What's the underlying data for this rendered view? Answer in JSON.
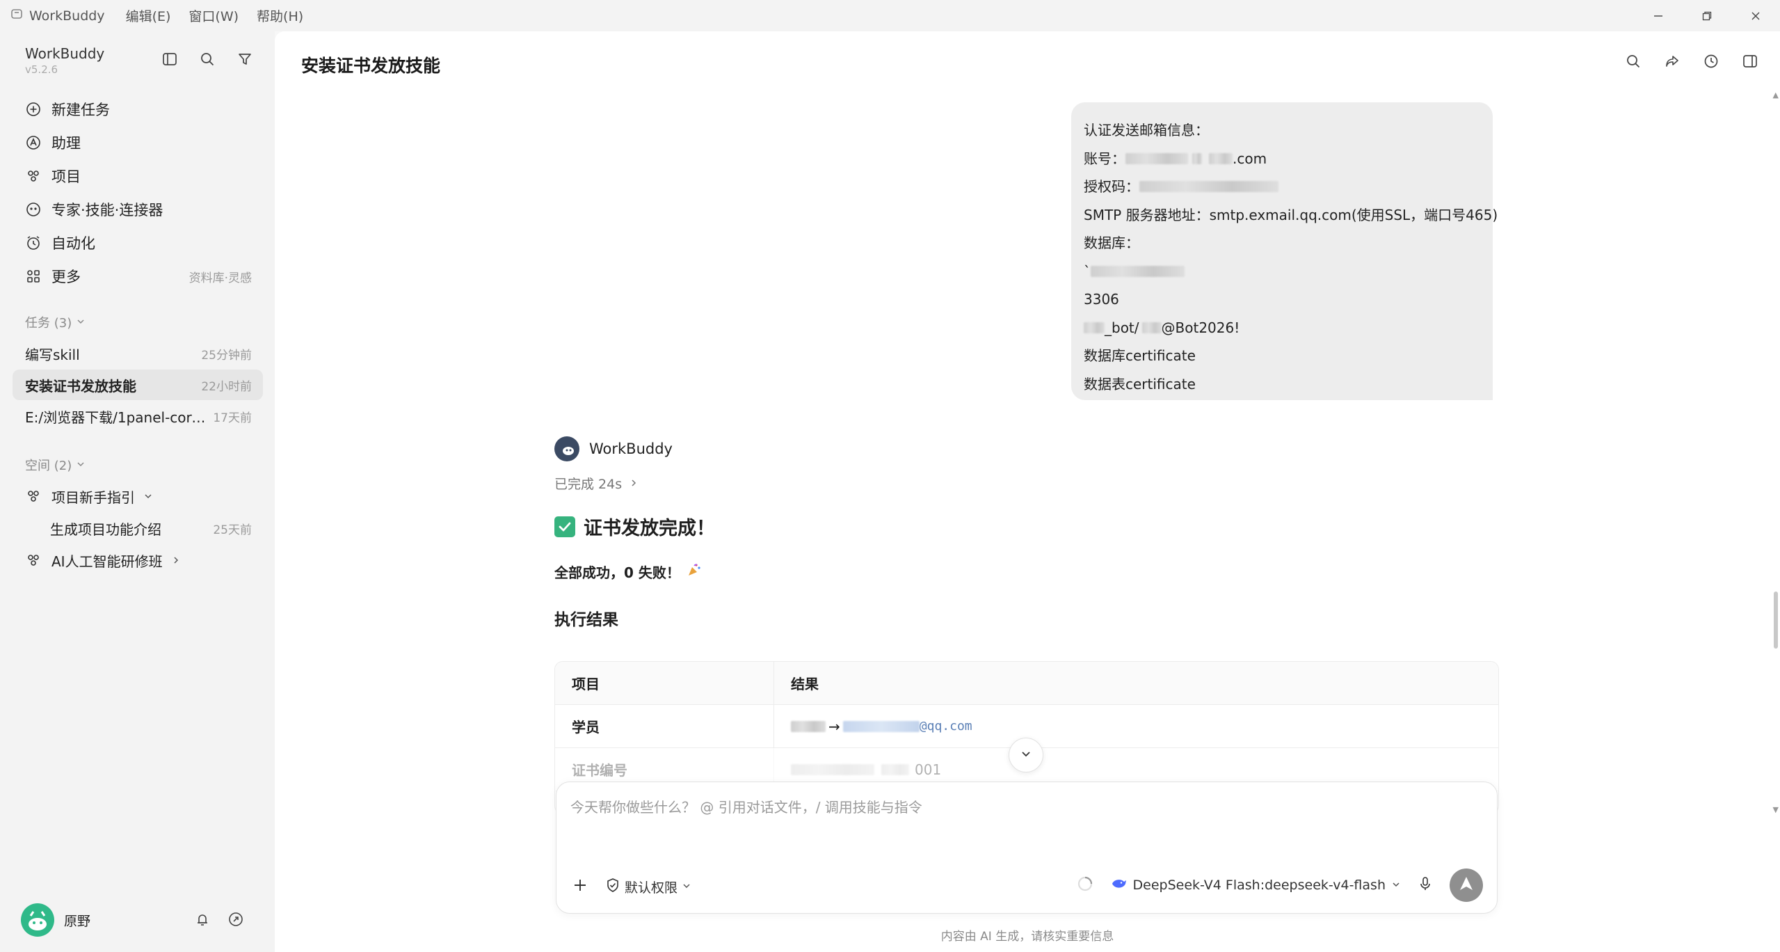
{
  "titlebar": {
    "app_name": "WorkBuddy",
    "menus": [
      "编辑(E)",
      "窗口(W)",
      "帮助(H)"
    ]
  },
  "sidebar": {
    "brand": "WorkBuddy",
    "version": "v5.2.6",
    "nav": [
      {
        "label": "新建任务",
        "icon": "plus-circle-icon"
      },
      {
        "label": "助理",
        "icon": "assistant-icon"
      },
      {
        "label": "项目",
        "icon": "project-icon"
      },
      {
        "label": "专家·技能·连接器",
        "icon": "expert-icon"
      },
      {
        "label": "自动化",
        "icon": "clock-icon"
      },
      {
        "label": "更多",
        "icon": "apps-icon",
        "hint": "资料库·灵感"
      }
    ],
    "tasks_label": "任务 (3)",
    "tasks": [
      {
        "title": "编写skill",
        "time": "25分钟前"
      },
      {
        "title": "安装证书发放技能",
        "time": "22小时前",
        "active": true
      },
      {
        "title": "E:/浏览器下载/1panel-cordy...",
        "time": "17天前"
      }
    ],
    "spaces_label": "空间 (2)",
    "spaces": [
      {
        "title": "项目新手指引",
        "children": [
          {
            "title": "生成项目功能介绍",
            "time": "25天前"
          }
        ]
      },
      {
        "title": "AI人工智能研修班"
      }
    ],
    "user": {
      "name": "原野"
    }
  },
  "main": {
    "title": "安装证书发放技能",
    "user_message": {
      "lines": [
        "认证发送邮箱信息：",
        "账号：",
        ".com",
        "授权码：",
        "SMTP 服务器地址：smtp.exmail.qq.com(使用SSL，端口号465)",
        "数据库：",
        "`",
        "3306",
        "_bot/",
        "@Bot2026!",
        "数据库certificate",
        "数据表certificate"
      ]
    },
    "assistant": {
      "name": "WorkBuddy",
      "status": "已完成 24s",
      "heading": "证书发放完成！",
      "summary": "全部成功，0 失败！",
      "section": "执行结果",
      "table": {
        "headers": [
          "项目",
          "结果"
        ],
        "rows": [
          {
            "item": "学员",
            "arrow": "→",
            "value": "@qq.com"
          },
          {
            "item": "证书编号",
            "value": "001"
          }
        ]
      }
    },
    "composer": {
      "placeholder": "今天帮你做些什么？ @ 引用对话文件，/ 调用技能与指令",
      "permission": "默认权限",
      "model": "DeepSeek-V4 Flash:deepseek-v4-flash"
    },
    "footer": "内容由 AI 生成，请核实重要信息"
  }
}
